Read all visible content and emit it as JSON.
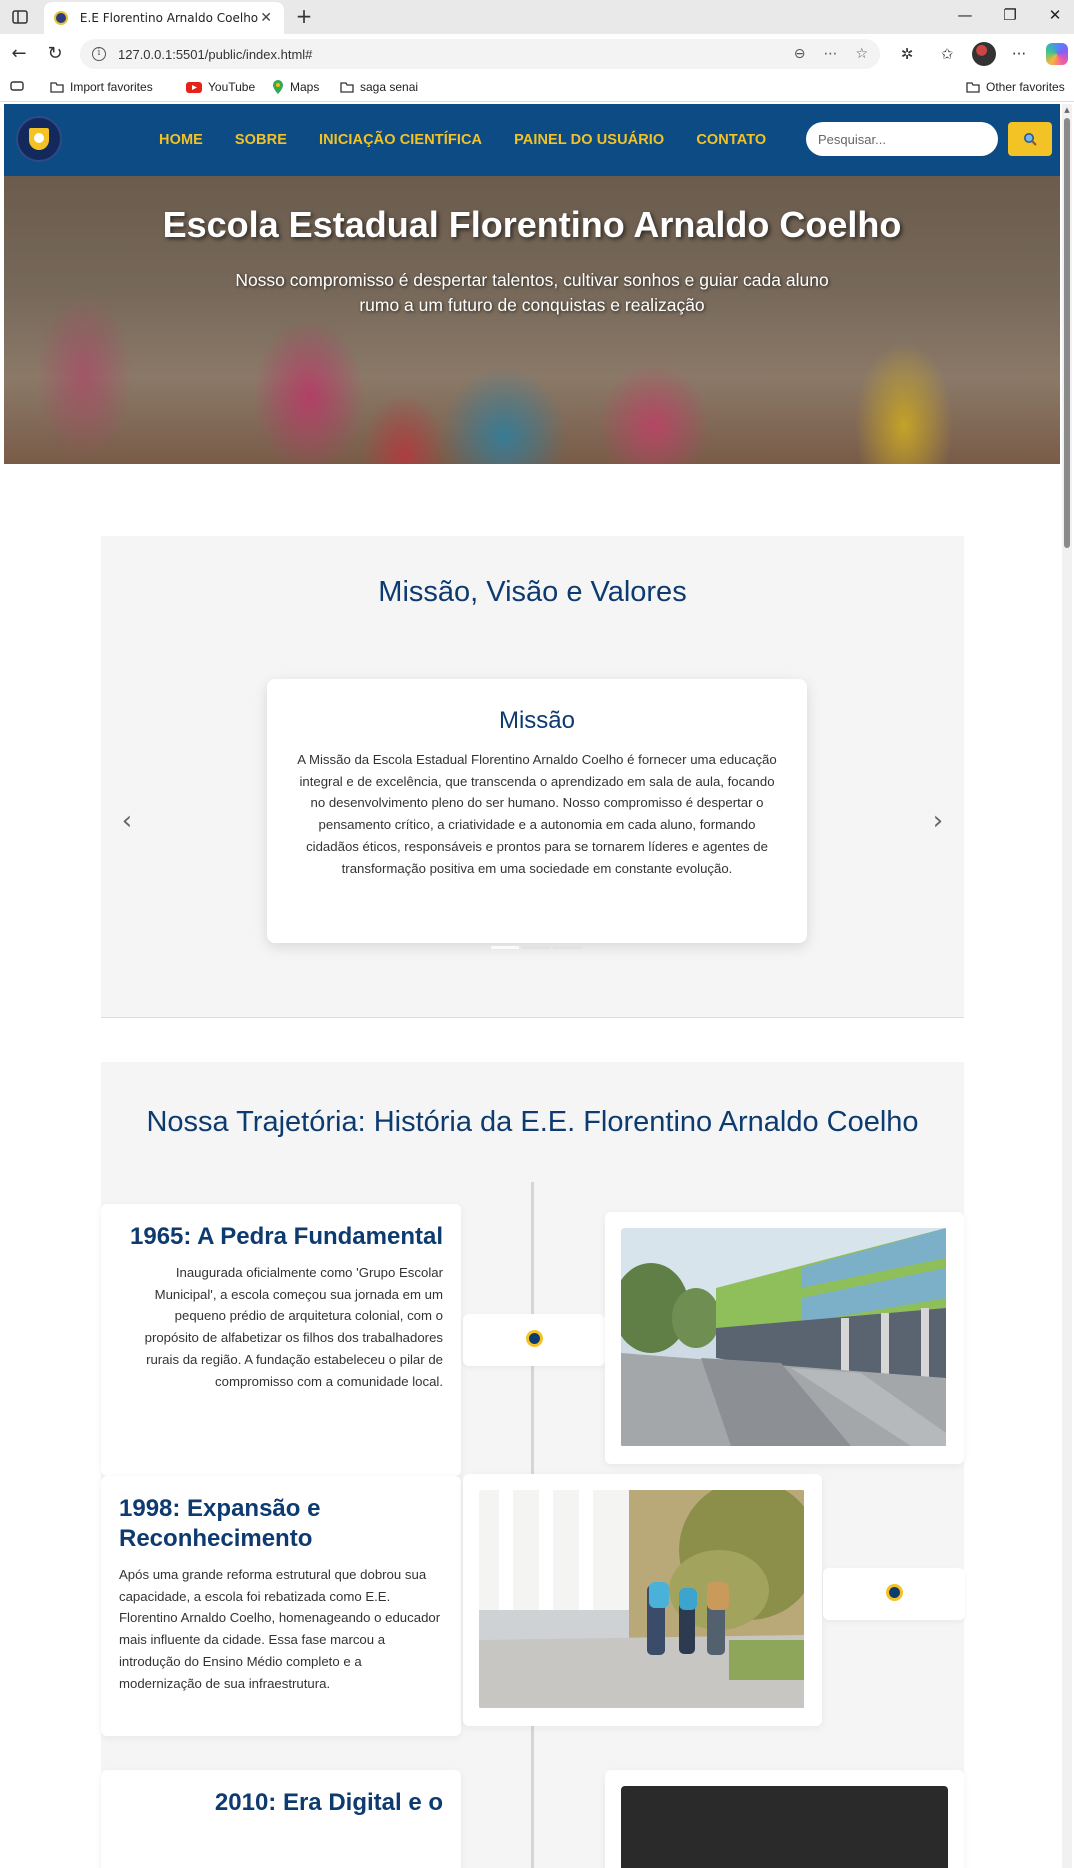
{
  "browser": {
    "tab_title": "E.E Florentino Arnaldo Coelho",
    "url": "127.0.0.1:5501/public/index.html#",
    "bookmarks": [
      "Import favorites",
      "YouTube",
      "Maps",
      "saga senai"
    ],
    "other_favorites": "Other favorites"
  },
  "nav": {
    "items": [
      "HOME",
      "SOBRE",
      "INICIAÇÃO CIENTÍFICA",
      "PAINEL DO USUÁRIO",
      "CONTATO"
    ],
    "search_placeholder": "Pesquisar..."
  },
  "hero": {
    "title": "Escola Estadual Florentino Arnaldo Coelho",
    "subtitle": "Nosso compromisso é despertar talentos, cultivar sonhos e guiar cada aluno rumo a um futuro de conquistas e realização"
  },
  "mvv": {
    "heading": "Missão, Visão e Valores",
    "card_title": "Missão",
    "card_text": "A Missão da Escola Estadual Florentino Arnaldo Coelho é fornecer uma educação integral e de excelência, que transcenda o aprendizado em sala de aula, focando no desenvolvimento pleno do ser humano. Nosso compromisso é despertar o pensamento crítico, a criatividade e a autonomia em cada aluno, formando cidadãos éticos, responsáveis e prontos para se tornarem líderes e agentes de transformação positiva em uma sociedade em constante evolução.",
    "prev": "‹",
    "next": "›"
  },
  "history": {
    "heading": "Nossa Trajetória: História da E.E. Florentino Arnaldo Coelho",
    "events": [
      {
        "title": "1965: A Pedra Fundamental",
        "text": "Inaugurada oficialmente como 'Grupo Escolar Municipal', a escola começou sua jornada em um pequeno prédio de arquitetura colonial, com o propósito de alfabetizar os filhos dos trabalhadores rurais da região. A fundação estabeleceu o pilar de compromisso com a comunidade local."
      },
      {
        "title": "1998: Expansão e Reconhecimento",
        "text": "Após uma grande reforma estrutural que dobrou sua capacidade, a escola foi rebatizada como E.E. Florentino Arnaldo Coelho, homenageando o educador mais influente da cidade. Essa fase marcou a introdução do Ensino Médio completo e a modernização de sua infraestrutura."
      },
      {
        "title": "2010: Era Digital e o"
      }
    ]
  }
}
